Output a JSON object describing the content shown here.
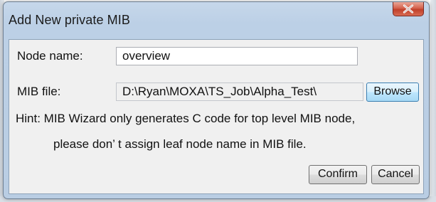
{
  "dialog": {
    "title": "Add New private MIB",
    "close_icon": "close-x-icon"
  },
  "form": {
    "node_name_label": "Node name:",
    "node_name_value": "overview",
    "mib_file_label": "MIB file:",
    "mib_file_value": "D:\\Ryan\\MOXA\\TS_Job\\Alpha_Test\\",
    "browse_label": "Browse"
  },
  "hint": {
    "line1": "Hint: MIB Wizard only generates C code for top level MIB node,",
    "line2": "please don’ t assign leaf node name in MIB file."
  },
  "buttons": {
    "confirm_label": "Confirm",
    "cancel_label": "Cancel"
  },
  "colors": {
    "frame": "#b9cde3",
    "client_bg": "#f0f0f0",
    "close_red": "#c0402a",
    "browse_hover_blue": "#bee6fd"
  }
}
